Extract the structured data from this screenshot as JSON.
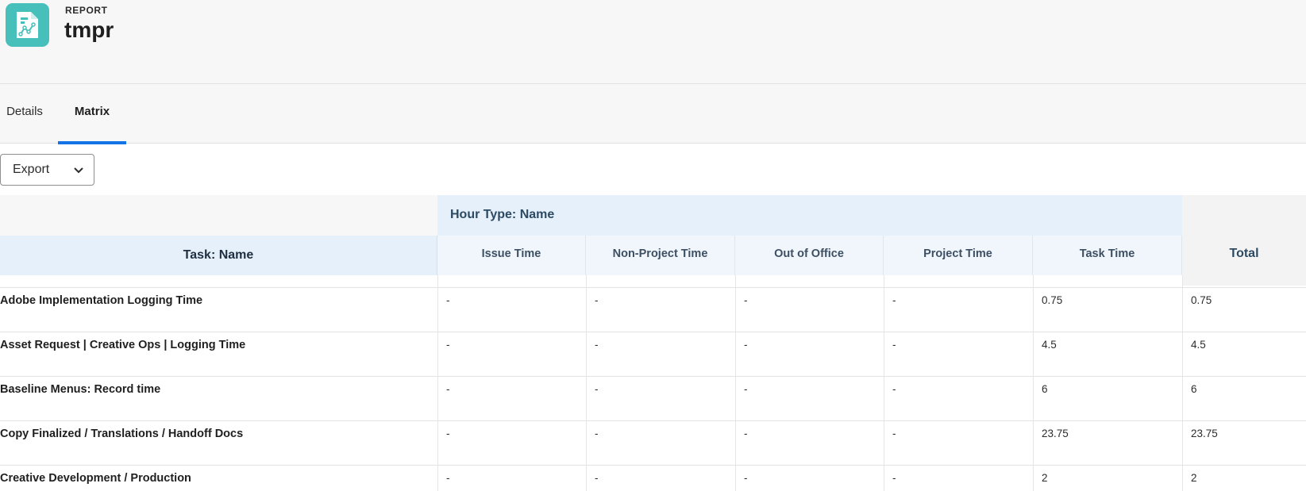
{
  "header": {
    "eyebrow": "REPORT",
    "title": "tmpr",
    "icon": "report-chart-icon",
    "icon_color": "#47c0bb"
  },
  "tabs": [
    {
      "label": "Details",
      "active": false
    },
    {
      "label": "Matrix",
      "active": true
    }
  ],
  "toolbar": {
    "export_label": "Export"
  },
  "matrix": {
    "group_header": "Hour Type: Name",
    "row_header": "Task: Name",
    "columns": [
      "Issue Time",
      "Non-Project Time",
      "Out of Office",
      "Project Time",
      "Task Time"
    ],
    "total_header": "Total",
    "rows": [
      {
        "task": "Adobe Implementation Logging Time",
        "values": [
          "-",
          "-",
          "-",
          "-",
          "0.75"
        ],
        "total": "0.75"
      },
      {
        "task": "Asset Request | Creative Ops | Logging Time",
        "values": [
          "-",
          "-",
          "-",
          "-",
          "4.5"
        ],
        "total": "4.5"
      },
      {
        "task": "Baseline Menus: Record time",
        "values": [
          "-",
          "-",
          "-",
          "-",
          "6"
        ],
        "total": "6"
      },
      {
        "task": "Copy Finalized / Translations / Handoff Docs",
        "values": [
          "-",
          "-",
          "-",
          "-",
          "23.75"
        ],
        "total": "23.75"
      },
      {
        "task": "Creative Development / Production",
        "values": [
          "-",
          "-",
          "-",
          "-",
          "2"
        ],
        "total": "2"
      }
    ]
  },
  "colors": {
    "accent": "#1473e6",
    "header_band": "#e6f0fb"
  }
}
